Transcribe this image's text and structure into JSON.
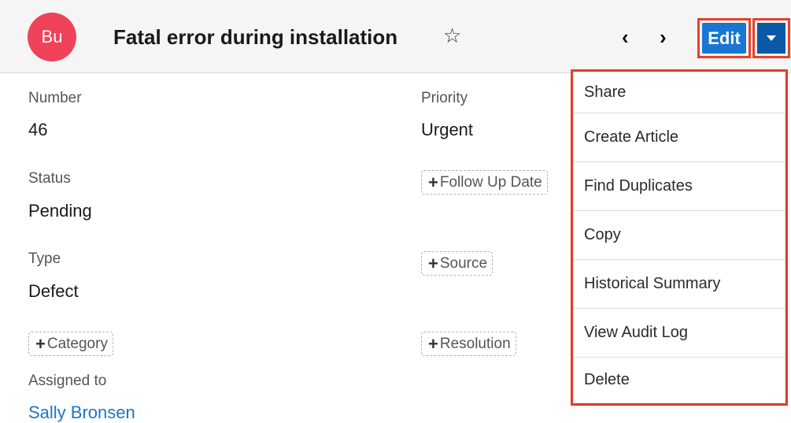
{
  "record": {
    "avatar_initials": "Bu",
    "title": "Fatal error during installation"
  },
  "header_actions": {
    "star_icon": "star-outline",
    "prev_icon": "chevron-left",
    "next_icon": "chevron-right",
    "edit_label": "Edit",
    "caret_icon": "caret-down"
  },
  "fields": {
    "number": {
      "label": "Number",
      "value": "46"
    },
    "priority": {
      "label": "Priority",
      "value": "Urgent"
    },
    "status": {
      "label": "Status",
      "value": "Pending"
    },
    "type": {
      "label": "Type",
      "value": "Defect"
    },
    "assigned_to": {
      "label": "Assigned to",
      "value": "Sally Bronsen"
    }
  },
  "empty_fields": {
    "follow_up_date": "Follow Up Date",
    "source": "Source",
    "category": "Category",
    "resolution": "Resolution"
  },
  "actions_menu": [
    "Share",
    "Create Article",
    "Find Duplicates",
    "Copy",
    "Historical Summary",
    "View Audit Log",
    "Delete"
  ],
  "colors": {
    "avatar": "#f0425a",
    "edit_button": "#1976d2",
    "caret_button": "#0a58a8",
    "link": "#1b75c9",
    "highlight": "#e8402a"
  }
}
